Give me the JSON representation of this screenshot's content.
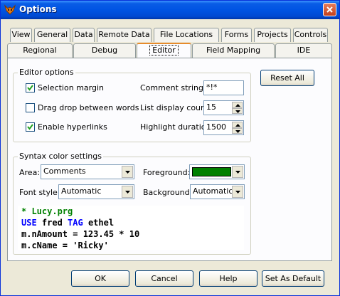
{
  "window": {
    "title": "Options"
  },
  "tabs_row1": [
    {
      "label": "View"
    },
    {
      "label": "General"
    },
    {
      "label": "Data"
    },
    {
      "label": "Remote Data"
    },
    {
      "label": "File Locations"
    },
    {
      "label": "Forms"
    },
    {
      "label": "Projects"
    },
    {
      "label": "Controls"
    }
  ],
  "tabs_row2": [
    {
      "label": "Regional"
    },
    {
      "label": "Debug"
    },
    {
      "label": "Editor",
      "active": true
    },
    {
      "label": "Field Mapping"
    },
    {
      "label": "IDE"
    }
  ],
  "editor_options": {
    "title": "Editor options",
    "selection_margin": {
      "label": "Selection margin",
      "checked": true
    },
    "drag_drop": {
      "label": "Drag drop between words",
      "checked": false
    },
    "hyperlinks": {
      "label": "Enable hyperlinks",
      "checked": true
    },
    "comment_string": {
      "label": "Comment string:",
      "value": "*!*"
    },
    "list_display_count": {
      "label": "List display count:",
      "value": "15"
    },
    "highlight_duration": {
      "label": "Highlight duration:",
      "value": "1500"
    }
  },
  "reset_all": "Reset All",
  "syntax": {
    "title": "Syntax color settings",
    "area": {
      "label": "Area:",
      "value": "Comments"
    },
    "font_style": {
      "label": "Font style:",
      "value": "Automatic"
    },
    "foreground": {
      "label": "Foreground:",
      "color": "#008000"
    },
    "background": {
      "label": "Background:",
      "value": "Automatic"
    }
  },
  "preview": [
    {
      "parts": [
        {
          "text": "* Lucy.prg",
          "color": "#008000"
        }
      ]
    },
    {
      "parts": [
        {
          "text": "USE",
          "color": "#0000ff"
        },
        {
          "text": " fred ",
          "color": "#000000"
        },
        {
          "text": "TAG",
          "color": "#0000ff"
        },
        {
          "text": " ethel",
          "color": "#000000"
        }
      ]
    },
    {
      "parts": [
        {
          "text": "m.nAmount = 123.45 * 10",
          "color": "#000000"
        }
      ]
    },
    {
      "parts": [
        {
          "text": "m.cName = 'Ricky'",
          "color": "#000000"
        }
      ]
    }
  ],
  "buttons": {
    "ok": "OK",
    "cancel": "Cancel",
    "help": "Help",
    "set_default": "Set As Default"
  }
}
